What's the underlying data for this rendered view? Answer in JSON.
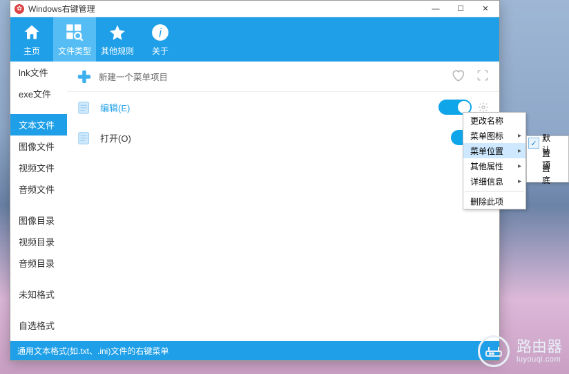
{
  "window": {
    "title": "Windows右键管理"
  },
  "toolbar": {
    "home": "主页",
    "filetype": "文件类型",
    "otherrules": "其他规则",
    "about": "关于"
  },
  "sidebar": {
    "items": [
      "lnk文件",
      "exe文件",
      "文本文件",
      "图像文件",
      "视频文件",
      "音频文件",
      "图像目录",
      "视频目录",
      "音频目录",
      "未知格式",
      "自选格式"
    ],
    "activeIndex": 2
  },
  "content": {
    "new_label": "新建一个菜单项目",
    "rows": [
      {
        "label": "编辑(E)",
        "toggled": true,
        "selected": true
      },
      {
        "label": "打开(O)",
        "toggled": true,
        "selected": false
      }
    ]
  },
  "context_menu": {
    "items": [
      {
        "label": "更改名称",
        "sub": false
      },
      {
        "label": "菜单图标",
        "sub": true
      },
      {
        "label": "菜单位置",
        "sub": true,
        "highlight": true
      },
      {
        "label": "其他属性",
        "sub": true
      },
      {
        "label": "详细信息",
        "sub": true
      },
      {
        "label": "删除此项",
        "sub": false,
        "sepBefore": true
      }
    ],
    "submenu": [
      {
        "label": "默认",
        "checked": true
      },
      {
        "label": "置顶",
        "checked": false
      },
      {
        "label": "置底",
        "checked": false
      }
    ]
  },
  "statusbar": "通用文本格式(如.txt、.ini)文件的右键菜单",
  "branding": {
    "cn": "路由器",
    "py": "luyouqi.com"
  }
}
